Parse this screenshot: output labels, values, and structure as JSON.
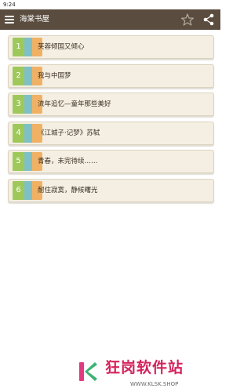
{
  "status_bar": {
    "time": "9:24"
  },
  "app_bar": {
    "title": "海棠书屋",
    "icons": {
      "menu": "menu-icon",
      "favorite": "star-icon",
      "share": "share-icon"
    },
    "colors": {
      "background": "#5a4d3f",
      "foreground": "#ffffff"
    }
  },
  "books": [
    {
      "number": "1",
      "title": "芙蓉倾国又倾心"
    },
    {
      "number": "2",
      "title": "我与中国梦"
    },
    {
      "number": "3",
      "title": "流年追忆—童年那些美好"
    },
    {
      "number": "4",
      "title": "《江城子·记梦》苏轼"
    },
    {
      "number": "5",
      "title": "青春，未完待续……"
    },
    {
      "number": "6",
      "title": "耐住寂寞，静候曙光"
    }
  ],
  "book_spine_colors": {
    "green": "#9ec95a",
    "teal": "#7fc0c6",
    "orange": "#f0b164"
  },
  "watermark": {
    "name": "狂岗软件站",
    "url": "WWW.KLSK.SHOP",
    "colors": {
      "name": "#d5235d",
      "logo_pink": "#e23a7e",
      "logo_green": "#3db371"
    }
  }
}
